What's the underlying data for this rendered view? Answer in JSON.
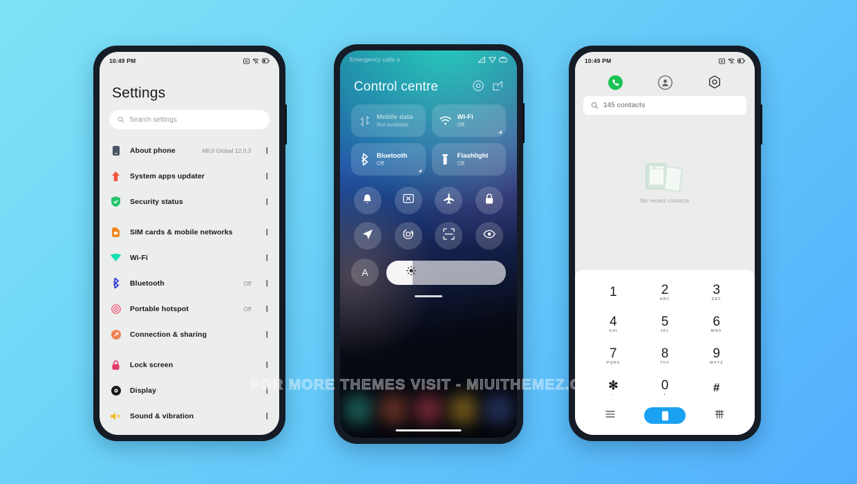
{
  "background": {
    "from": "#7fe2f7",
    "to": "#54aefc"
  },
  "watermark": "FOR MORE THEMES VISIT - MIUITHEMEZ.COM",
  "settings_phone": {
    "status": {
      "time": "10:49 PM"
    },
    "title": "Settings",
    "search_placeholder": "Search settings",
    "items": [
      {
        "label": "About phone",
        "value": "MIUI Global 12.0.3",
        "icon": "phone-icon",
        "color": "#4b5563"
      },
      {
        "label": "System apps updater",
        "value": "",
        "icon": "up-arrow-icon",
        "color": "#f4503c"
      },
      {
        "label": "Security status",
        "value": "",
        "icon": "shield-check-icon",
        "color": "#22c46b"
      },
      {
        "label": "SIM cards & mobile networks",
        "value": "",
        "icon": "sim-card-icon",
        "color": "#f08a23"
      },
      {
        "label": "Wi-Fi",
        "value": "",
        "icon": "wifi-icon",
        "color": "#17e0b0"
      },
      {
        "label": "Bluetooth",
        "value": "Off",
        "icon": "bluetooth-icon",
        "color": "#3b46d8"
      },
      {
        "label": "Portable hotspot",
        "value": "Off",
        "icon": "hotspot-icon",
        "color": "#f2607a"
      },
      {
        "label": "Connection & sharing",
        "value": "",
        "icon": "share-icon",
        "color": "#f08050"
      },
      {
        "label": "Lock screen",
        "value": "",
        "icon": "lock-icon",
        "color": "#e03a68"
      },
      {
        "label": "Display",
        "value": "",
        "icon": "display-icon",
        "color": "#17181a"
      },
      {
        "label": "Sound & vibration",
        "value": "",
        "icon": "sound-icon",
        "color": "#f5bb25"
      }
    ],
    "arrow": "❙"
  },
  "control_centre": {
    "status": {
      "carrier": "Emergency calls o"
    },
    "title": "Control centre",
    "header_icons": [
      {
        "name": "settings-gear-icon"
      },
      {
        "name": "edit-icon"
      }
    ],
    "tiles": [
      {
        "name": "Mobile data",
        "sub": "Not available",
        "icon": "mobile-data-icon",
        "state": "dim",
        "expandable": false
      },
      {
        "name": "Wi-Fi",
        "sub": "Off",
        "icon": "wifi-icon",
        "state": "off",
        "expandable": true
      },
      {
        "name": "Bluetooth",
        "sub": "Off",
        "icon": "bluetooth-icon",
        "state": "off",
        "expandable": true
      },
      {
        "name": "Flashlight",
        "sub": "Off",
        "icon": "flashlight-icon",
        "state": "off",
        "expandable": false
      }
    ],
    "round_buttons": [
      {
        "name": "silent-bell-icon"
      },
      {
        "name": "screenshot-icon"
      },
      {
        "name": "airplane-mode-icon"
      },
      {
        "name": "lock-icon"
      },
      {
        "name": "location-icon"
      },
      {
        "name": "auto-rotate-icon"
      },
      {
        "name": "scanner-icon"
      },
      {
        "name": "reading-mode-icon"
      }
    ],
    "auto_brightness_label": "A",
    "brightness_percent": 22,
    "dock_colors": [
      "#1f6f63",
      "#7a3a2a",
      "#8d2f3a",
      "#8a6a1e",
      "#2a3a6a"
    ]
  },
  "dialer_phone": {
    "status": {
      "time": "10:49 PM"
    },
    "tabs": [
      {
        "name": "calls-tab",
        "icon": "phone-handset-icon",
        "active": true,
        "color": "#19c353"
      },
      {
        "name": "contacts-tab",
        "icon": "contact-add-icon",
        "active": false
      },
      {
        "name": "settings-tab",
        "icon": "gear-icon",
        "active": false
      }
    ],
    "search_placeholder": "145 contacts",
    "empty_state": "No recent contacts",
    "keys": [
      {
        "num": "1",
        "sub": ""
      },
      {
        "num": "2",
        "sub": "ABC"
      },
      {
        "num": "3",
        "sub": "DEF"
      },
      {
        "num": "4",
        "sub": "GHI"
      },
      {
        "num": "5",
        "sub": "JKL"
      },
      {
        "num": "6",
        "sub": "MNO"
      },
      {
        "num": "7",
        "sub": "PQRS"
      },
      {
        "num": "8",
        "sub": "TUV"
      },
      {
        "num": "9",
        "sub": "WXYZ"
      },
      {
        "num": "✻",
        "sub": ","
      },
      {
        "num": "0",
        "sub": "+"
      },
      {
        "num": "#",
        "sub": ""
      }
    ],
    "actions": {
      "menu_icon": "list-menu-icon",
      "call_icon": "dialpad-call-icon",
      "keypad_icon": "keypad-grid-icon",
      "call_color": "#1ba1f2"
    }
  }
}
